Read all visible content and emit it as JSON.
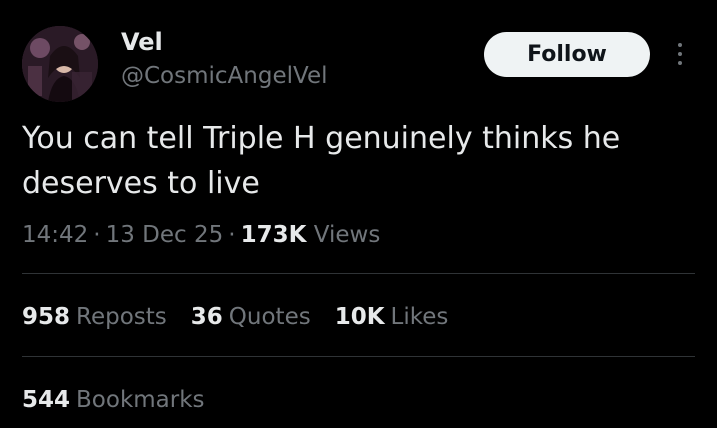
{
  "author": {
    "display_name": "Vel",
    "handle": "@CosmicAngelVel"
  },
  "actions": {
    "follow_label": "Follow",
    "more_icon": "more-vertical-icon"
  },
  "tweet": {
    "text": "You can tell Triple H genuinely thinks he deserves to live",
    "time": "14:42",
    "date": "13 Dec 25",
    "separator": "·",
    "views_count": "173K",
    "views_label": "Views"
  },
  "stats": [
    {
      "count": "958",
      "label": "Reposts"
    },
    {
      "count": "36",
      "label": "Quotes"
    },
    {
      "count": "10K",
      "label": "Likes"
    }
  ],
  "bookmarks": {
    "count": "544",
    "label": "Bookmarks"
  },
  "colors": {
    "background": "#000000",
    "primary_text": "#e7e9ea",
    "secondary_text": "#71767b",
    "divider": "#2f3336",
    "follow_button_bg": "#eff3f4"
  }
}
